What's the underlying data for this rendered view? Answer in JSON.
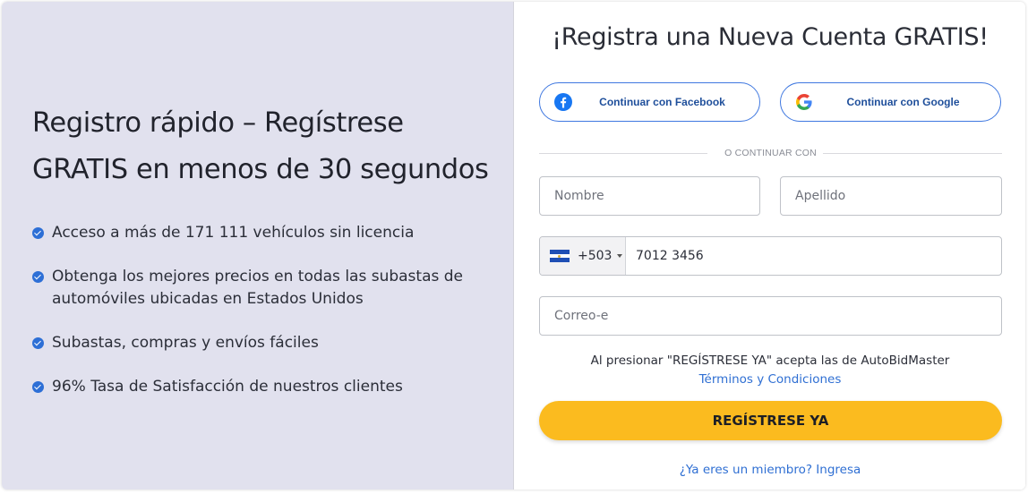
{
  "left_panel": {
    "headline_line1": "Registro rápido – Regístrese",
    "headline_line2": "GRATIS en menos de 30 segundos",
    "benefits": [
      "Acceso a más de 171 111 vehículos sin licencia",
      "Obtenga los mejores precios en todas las subastas de",
      "automóviles ubicadas en Estados Unidos",
      "Subastas, compras y envíos fáciles",
      "96% Tasa de Satisfacción de nuestros clientes"
    ]
  },
  "form": {
    "title": "¡Registra una Nueva Cuenta GRATIS!",
    "facebook_label": "Continuar con Facebook",
    "google_label": "Continuar con Google",
    "divider_text": "O CONTINUAR CON",
    "first_name_placeholder": "Nombre",
    "last_name_placeholder": "Apellido",
    "phone": {
      "country_code": "+503",
      "value": "7012 3456",
      "flag_icon": "el-salvador-flag-icon"
    },
    "email_placeholder": "Correo-e",
    "terms_text": "Al presionar \"REGÍSTRESE YA\" acepta las de AutoBidMaster",
    "terms_link": "Términos y Condiciones",
    "submit_label": "REGÍSTRESE YA",
    "member_link": "¿Ya eres un miembro? Ingresa"
  },
  "colors": {
    "left_bg": "#e1e1ee",
    "accent_blue": "#2f6fd3",
    "cta_yellow": "#fbbb1f"
  }
}
